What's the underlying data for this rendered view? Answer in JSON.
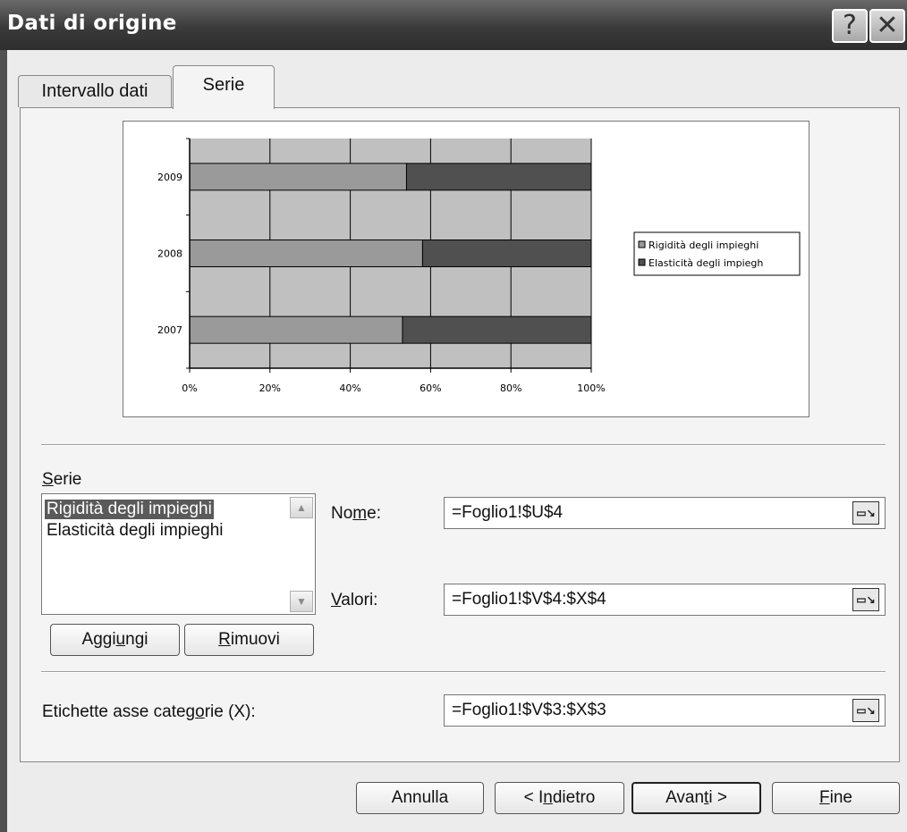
{
  "title": "Dati di origine",
  "title_buttons": {
    "help": "?",
    "close": "✕"
  },
  "tabs": [
    {
      "label": "Intervallo dati"
    },
    {
      "label": "Serie"
    }
  ],
  "chart_data": {
    "type": "bar",
    "orientation": "horizontal",
    "stacked": "100%",
    "categories": [
      "2009",
      "2008",
      "2007"
    ],
    "x_ticks": [
      "0%",
      "20%",
      "40%",
      "60%",
      "80%",
      "100%"
    ],
    "xlim": [
      0,
      100
    ],
    "grid": true,
    "legend_position": "right",
    "series": [
      {
        "name": "Rigidità degli impieghi",
        "color": "#9a9a9a",
        "values": [
          54,
          58,
          53
        ]
      },
      {
        "name": "Elasticità degli impiegh",
        "color": "#505050",
        "values": [
          46,
          42,
          47
        ]
      }
    ]
  },
  "series_section": {
    "label": "Serie",
    "items": [
      "Rigidità degli impieghi",
      "Elasticità degli impieghi"
    ],
    "add_button": "Aggiungi",
    "remove_button": "Rimuovi"
  },
  "name_field": {
    "label": "Nome:",
    "value": "=Foglio1!$U$4"
  },
  "values_field": {
    "label": "Valori:",
    "value": "=Foglio1!$V$4:$X$4"
  },
  "category_field": {
    "label": "Etichette asse categorie (X):",
    "value": "=Foglio1!$V$3:$X$3"
  },
  "footer": {
    "cancel": "Annulla",
    "back": "< Indietro",
    "next": "Avanti >",
    "finish": "Fine"
  }
}
